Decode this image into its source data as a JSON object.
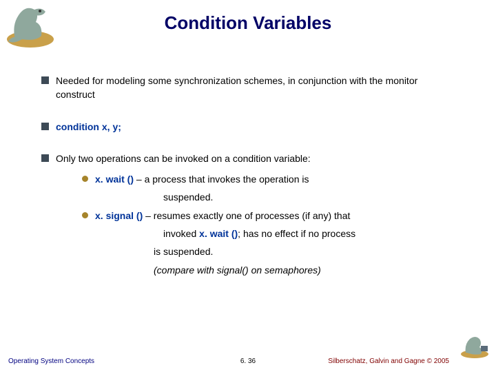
{
  "title": "Condition Variables",
  "bullets": {
    "b1": "Needed for modeling some synchronization schemes, in conjunction with the monitor construct",
    "b2": "condition x, y;",
    "b3": "Only two operations can be invoked on a condition variable:"
  },
  "sub": {
    "s1_kw": "x. wait ()",
    "s1_rest": " – a process that invokes the operation is",
    "s1_line2": "suspended.",
    "s2_kw": "x. signal ()",
    "s2_rest": " – resumes exactly one of processes (if any) that",
    "s2_line2a": "invoked ",
    "s2_line2_kw": "x. wait ()",
    "s2_line2b": "; has no effect if no process",
    "s2_line3": "is suspended.",
    "s2_line4": "(compare with signal() on semaphores)"
  },
  "footer": {
    "left": "Operating System Concepts",
    "center": "6. 36",
    "right": "Silberschatz, Galvin and Gagne © 2005"
  }
}
